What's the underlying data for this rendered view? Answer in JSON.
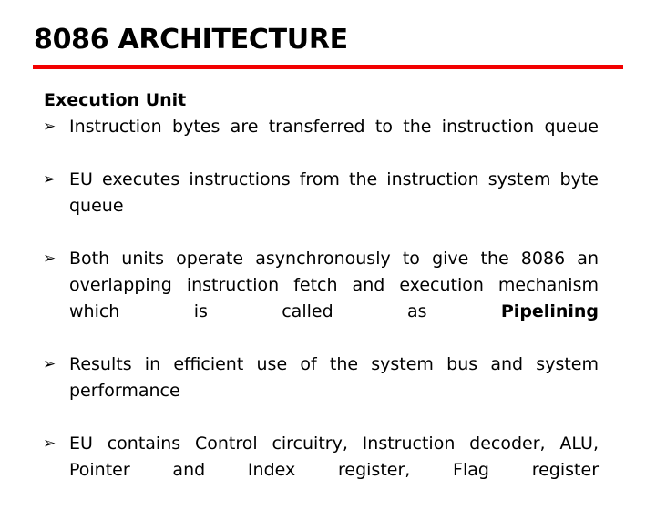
{
  "slide": {
    "title": "8086 ARCHITECTURE",
    "accent_color": "#f20000",
    "background_color": "#ffffff",
    "text_color": "#000000",
    "section_heading": "Execution Unit",
    "bullet_marker": "➢",
    "bullets": [
      {
        "text": "Instruction bytes are transferred to the instruction queue",
        "bold_segment": ""
      },
      {
        "text": "EU executes instructions from the instruction system byte queue",
        "bold_segment": ""
      },
      {
        "text": "Both units operate asynchronously to give the 8086 an overlapping instruction fetch and execution mechanism which is called as ",
        "bold_segment": "Pipelining"
      },
      {
        "text": "Results in efficient use of the system bus and system performance",
        "bold_segment": ""
      },
      {
        "text": "EU contains Control circuitry, Instruction decoder, ALU, Pointer and Index register, Flag register",
        "bold_segment": ""
      }
    ]
  }
}
